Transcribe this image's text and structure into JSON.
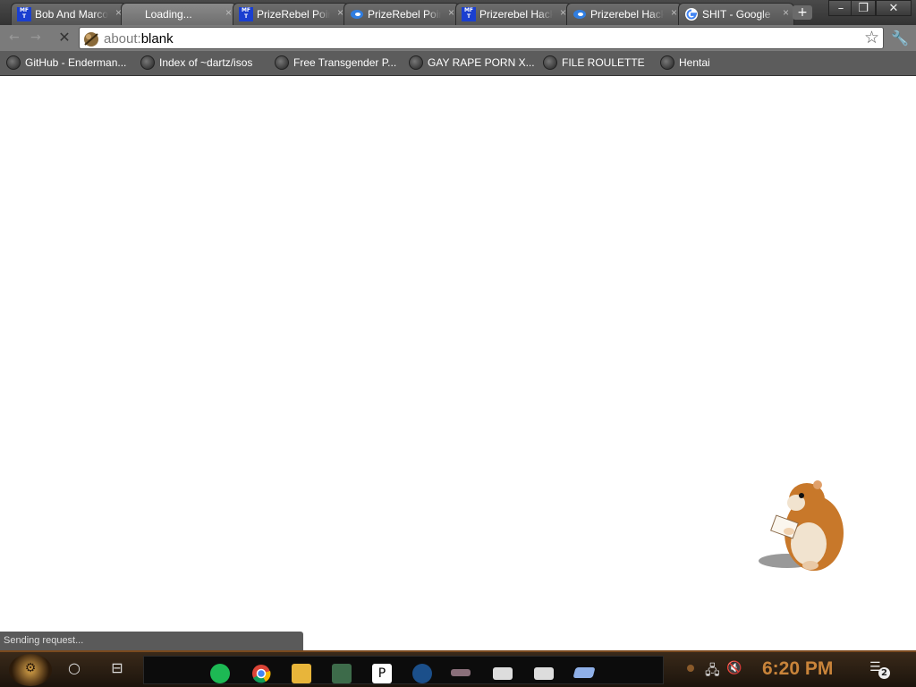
{
  "tabs": [
    {
      "title": "Bob And Marco",
      "favicon": "mft-icon",
      "active": false
    },
    {
      "title": "Loading...",
      "favicon": "none",
      "active": true
    },
    {
      "title": "PrizeRebel Points",
      "favicon": "mft-icon",
      "active": false
    },
    {
      "title": "PrizeRebel Points",
      "favicon": "blue-swirl-icon",
      "active": false
    },
    {
      "title": "Prizerebel Hack",
      "favicon": "mft-icon",
      "active": false
    },
    {
      "title": "Prizerebel Hack",
      "favicon": "blue-swirl-icon",
      "active": false
    },
    {
      "title": "SHIT - Google",
      "favicon": "google-icon",
      "active": false
    }
  ],
  "tab_close_glyph": "×",
  "new_tab_glyph": "+",
  "window_controls": {
    "minimize": "–",
    "restore": "❐",
    "close": "✕"
  },
  "toolbar": {
    "back_glyph": "←",
    "forward_glyph": "→",
    "stop_glyph": "✕",
    "url_scheme": "about:",
    "url_rest": "blank",
    "bookmark_star_glyph": "☆",
    "wrench_glyph": "🔧"
  },
  "bookmarks": [
    "GitHub - Enderman...",
    "Index of ~dartz/isos",
    "Free Transgender P...",
    "GAY RAPE PORN X...",
    "FILE ROULETTE",
    "Hentai"
  ],
  "status_text": "Sending request...",
  "taskbar": {
    "cortana_glyph": "○",
    "taskview_glyph": "⊟",
    "apps": [
      "spotify-icon",
      "chrome-icon",
      "file-explorer-icon",
      "photo-app-icon",
      "playstation-icon",
      "steam-icon",
      "usb-drive-icon",
      "folder-icon",
      "folder-icon",
      "window-app-icon"
    ],
    "tray_icons": [
      "network-icon",
      "volume-muted-icon"
    ],
    "clock": "6:20 PM",
    "notification_count": "2"
  },
  "colors": {
    "tab_bg": "#5f5f5f",
    "toolbar_bg": "#7b7b7b",
    "bookmarks_bg": "#5c5c5c",
    "taskbar_bg": "#2a1c10",
    "clock_color": "#c9843a",
    "mft_blue": "#1a3fd0"
  }
}
